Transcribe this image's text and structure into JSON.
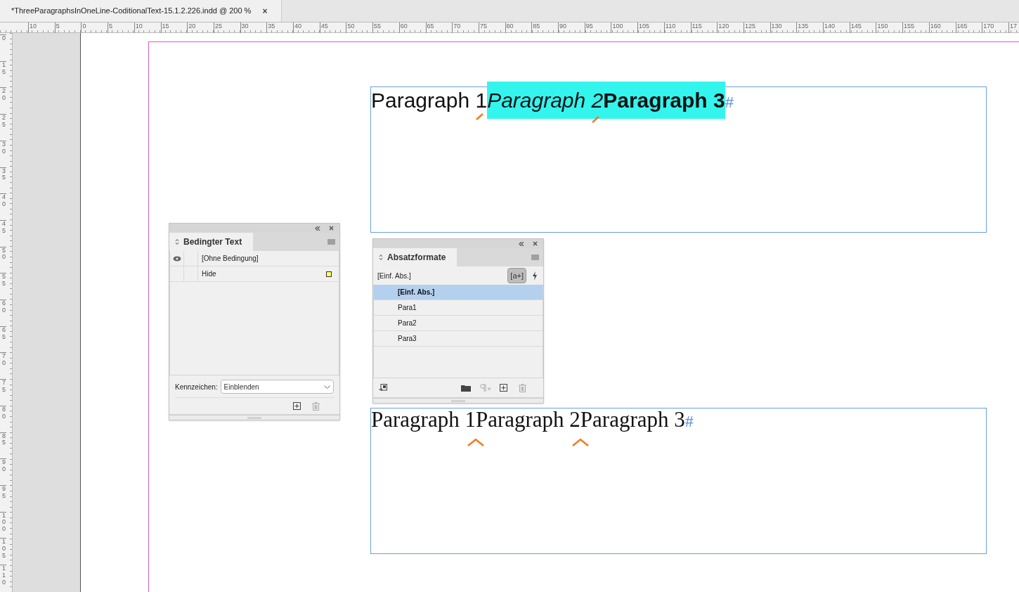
{
  "document_tab": {
    "title": "*ThreeParagraphsInOneLine-CoditionalText-15.1.2.226.indd @ 200 %",
    "close": "×"
  },
  "ruler_horizontal": [
    "10",
    "5",
    "0",
    "5",
    "10",
    "15",
    "20",
    "25",
    "30",
    "35",
    "40",
    "45",
    "50",
    "55",
    "60",
    "65",
    "70",
    "75",
    "80",
    "85",
    "90",
    "95",
    "100",
    "105",
    "110",
    "115",
    "120",
    "125",
    "130",
    "135",
    "140",
    "145",
    "150",
    "155",
    "160",
    "165",
    "170",
    "17"
  ],
  "ruler_vertical": [
    "0",
    "15",
    "20",
    "25",
    "30",
    "35",
    "40",
    "45",
    "50",
    "55",
    "60",
    "65",
    "70",
    "75",
    "80",
    "85",
    "90",
    "95",
    "100",
    "105",
    "110"
  ],
  "text_frames": [
    {
      "kind": "sans",
      "end_mark": "#",
      "runs": [
        {
          "text": "Paragraph 1",
          "kind": "plain",
          "highlighted": false,
          "condition_marker": true
        },
        {
          "text": "Paragraph 2",
          "kind": "emphasis",
          "highlighted": true,
          "condition_marker": true
        },
        {
          "text": "Paragraph 3",
          "kind": "strong",
          "highlighted": true,
          "condition_marker": false
        }
      ]
    },
    {
      "kind": "serif",
      "end_mark": "#",
      "runs": [
        {
          "text": "Paragraph 1",
          "kind": "plain",
          "highlighted": false,
          "condition_marker": true
        },
        {
          "text": "Paragraph 2",
          "kind": "plain",
          "highlighted": false,
          "condition_marker": true
        },
        {
          "text": "Paragraph 3",
          "kind": "plain",
          "highlighted": false,
          "condition_marker": false
        }
      ]
    }
  ],
  "conditions_panel": {
    "title": "Bedingter Text",
    "conditions": [
      {
        "name": "[Ohne Bedingung]",
        "visible": true
      },
      {
        "name": "Hide",
        "visible": false,
        "color": "#ffff66"
      }
    ],
    "indicator_label": "Kennzeichen:",
    "indicator_value": "Einblenden"
  },
  "paragraph_styles_panel": {
    "title": "Absatzformate",
    "current": "[Einf. Abs.]",
    "new_style_label": "[a+]",
    "styles": [
      {
        "name": "[Einf. Abs.]",
        "selected": true
      },
      {
        "name": "Para1",
        "selected": false
      },
      {
        "name": "Para2",
        "selected": false
      },
      {
        "name": "Para3",
        "selected": false
      }
    ]
  }
}
